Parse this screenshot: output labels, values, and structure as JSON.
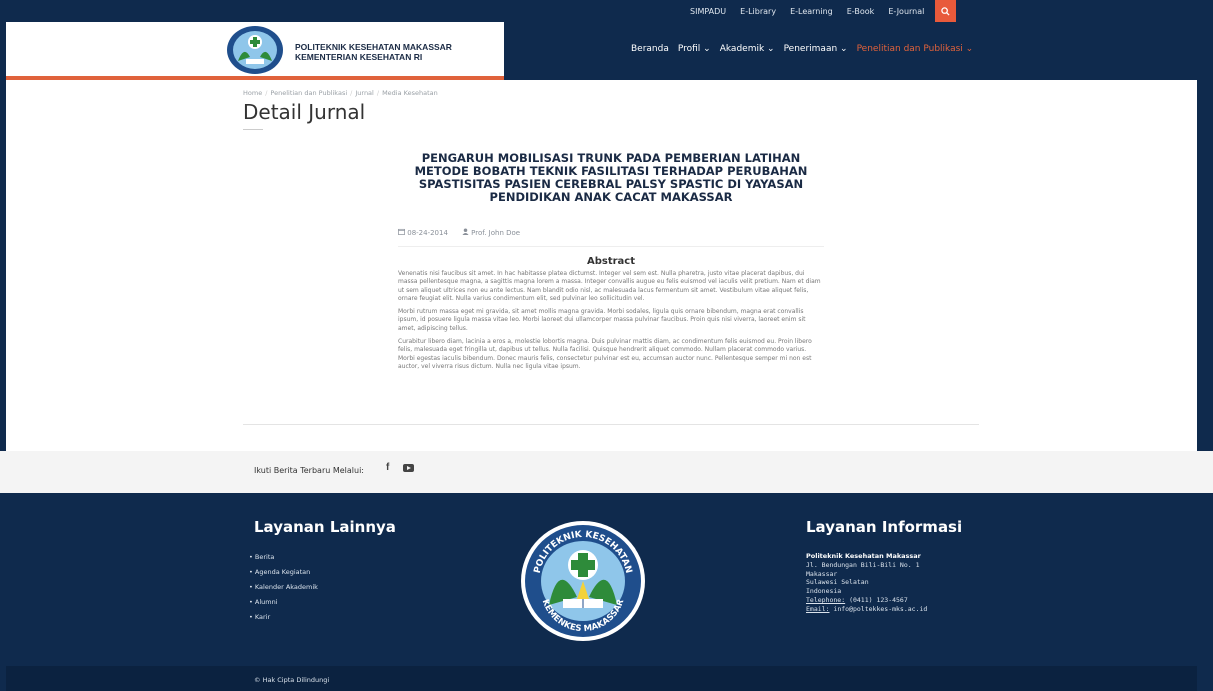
{
  "topbar": {
    "links": [
      "SIMPADU",
      "E-Library",
      "E-Learning",
      "E-Book",
      "E-Journal"
    ],
    "search_icon": "search-icon"
  },
  "brand": {
    "line1": "POLITEKNIK KESEHATAN MAKASSAR",
    "line2": "KEMENTERIAN KESEHATAN RI"
  },
  "nav": {
    "items": [
      "Beranda",
      "Profil ⌄",
      "Akademik ⌄",
      "Penerimaan ⌄",
      "Penelitian dan Publikasi ⌄"
    ],
    "active_color": "#e0623b"
  },
  "breadcrumb": {
    "items": [
      "Home",
      "Penelitian dan Publikasi",
      "Jurnal",
      "Media Kesehatan"
    ]
  },
  "page": {
    "title": "Detail Jurnal"
  },
  "article": {
    "title": "PENGARUH MOBILISASI TRUNK PADA PEMBERIAN LATIHAN METODE BOBATH TEKNIK FASILITASI TERHADAP PERUBAHAN SPASTISITAS PASIEN CEREBRAL PALSY SPASTIC DI YAYASAN PENDIDIKAN ANAK CACAT MAKASSAR",
    "date": "08-24-2014",
    "author": "Prof. John Doe",
    "abstract_heading": "Abstract",
    "paragraphs": [
      "Venenatis nisi faucibus sit amet. In hac habitasse platea dictumst. Integer vel sem est. Nulla pharetra, justo vitae placerat dapibus, dui massa pellentesque magna, a sagittis magna lorem a massa. Integer convallis augue eu felis euismod vel iaculis velit pretium. Nam et diam ut sem aliquet ultrices non eu ante lectus. Nam blandit odio nisl, ac malesuada lacus fermentum sit amet. Vestibulum vitae aliquet felis, ornare feugiat elit. Nulla varius condimentum elit, sed pulvinar leo sollicitudin vel.",
      "Morbi rutrum massa eget mi gravida, sit amet mollis magna gravida. Morbi sodales, ligula quis ornare bibendum, magna erat convallis ipsum, id posuere ligula massa vitae leo. Morbi laoreet dui ullamcorper massa pulvinar faucibus. Proin quis nisi viverra, laoreet enim sit amet, adipiscing tellus.",
      "Curabitur libero diam, lacinia a eros a, molestie lobortis magna. Duis pulvinar mattis diam, ac condimentum felis euismod eu. Proin libero felis, malesuada eget fringilla ut, dapibus ut tellus. Nulla facilisi. Quisque hendrerit aliquet commodo. Nullam placerat commodo varius. Morbi egestas iaculis bibendum. Donec mauris felis, consectetur pulvinar est eu, accumsan auctor nunc. Pellentesque semper mi non est auctor, vel viverra risus dictum. Nulla nec ligula vitae ipsum."
    ]
  },
  "follow": {
    "label": "Ikuti Berita Terbaru Melalui:",
    "facebook_glyph": "f"
  },
  "footer": {
    "left_heading": "Layanan Lainnya",
    "links": [
      "Berita",
      "Agenda Kegiatan",
      "Kalender Akademik",
      "Alumni",
      "Karir"
    ],
    "logo_text_top": "POLITEKNIK KESEHATAN",
    "logo_text_bottom": "KEMENKES MAKASSAR",
    "right_heading": "Layanan Informasi",
    "org": "Politeknik Kesehatan Makassar",
    "address": [
      "Jl. Bendungan Bili-Bili No. 1",
      "Makassar",
      "Sulawesi Selatan",
      "Indonesia"
    ],
    "phone_label": "Telephone:",
    "phone": "(0411) 123-4567",
    "email_label": "Email:",
    "email": "info@poltekkes-mks.ac.id",
    "copyright": "© Hak Cipta Dilindungi"
  },
  "colors": {
    "navy": "#0f2a4d",
    "accent": "#e0623b"
  }
}
